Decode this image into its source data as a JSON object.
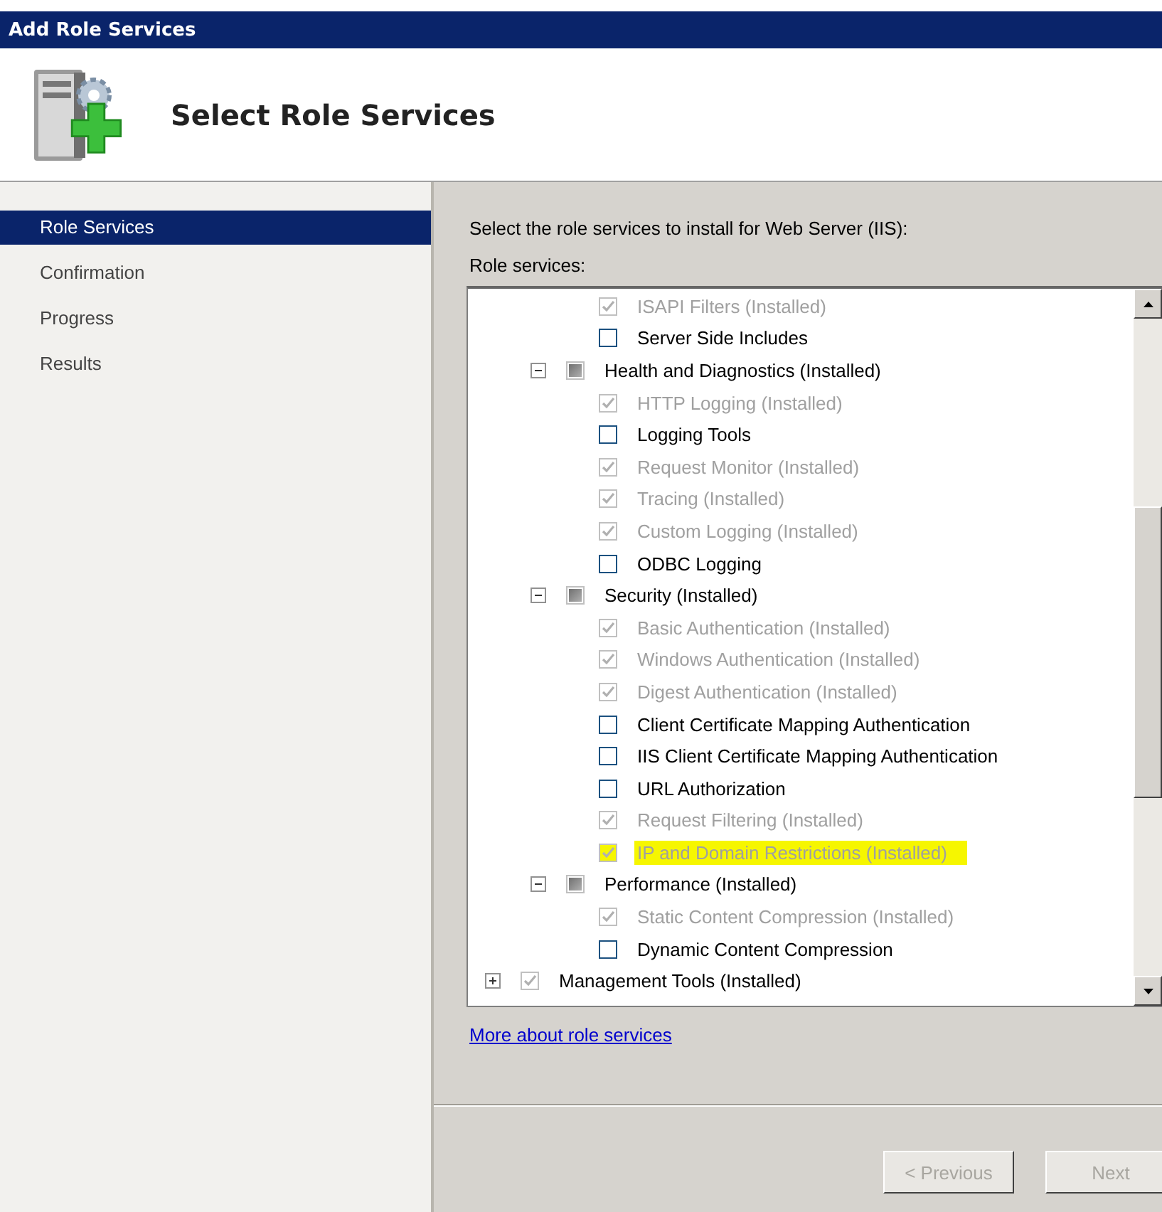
{
  "window": {
    "title": "Add Role Services"
  },
  "header": {
    "title": "Select Role Services"
  },
  "steps": [
    {
      "label": "Role Services",
      "selected": true
    },
    {
      "label": "Confirmation",
      "selected": false
    },
    {
      "label": "Progress",
      "selected": false
    },
    {
      "label": "Results",
      "selected": false
    }
  ],
  "content": {
    "instruction": "Select the role services to install for Web Server (IIS):",
    "list_label": "Role services:",
    "role_services": [
      {
        "children": [
          {
            "children": [
              {
                "label": "ISAPI Filters (Installed)",
                "checked": true,
                "disabled": true,
                "highlighted": false
              },
              {
                "label": "Server Side Includes",
                "checked": false,
                "disabled": false,
                "highlighted": false
              }
            ]
          },
          {
            "label": "Health and Diagnostics (Installed)",
            "checked": false,
            "partial": true,
            "expanded": true,
            "children": [
              {
                "label": "HTTP Logging (Installed)",
                "checked": true,
                "disabled": true,
                "highlighted": false
              },
              {
                "label": "Logging Tools",
                "checked": false,
                "disabled": false,
                "highlighted": false
              },
              {
                "label": "Request Monitor (Installed)",
                "checked": true,
                "disabled": true,
                "highlighted": false
              },
              {
                "label": "Tracing (Installed)",
                "checked": true,
                "disabled": true,
                "highlighted": false
              },
              {
                "label": "Custom Logging (Installed)",
                "checked": true,
                "disabled": true,
                "highlighted": false
              },
              {
                "label": "ODBC Logging",
                "checked": false,
                "disabled": false,
                "highlighted": false
              }
            ]
          },
          {
            "label": "Security (Installed)",
            "checked": false,
            "partial": true,
            "expanded": true,
            "children": [
              {
                "label": "Basic Authentication (Installed)",
                "checked": true,
                "disabled": true,
                "highlighted": false
              },
              {
                "label": "Windows Authentication (Installed)",
                "checked": true,
                "disabled": true,
                "highlighted": false
              },
              {
                "label": "Digest Authentication (Installed)",
                "checked": true,
                "disabled": true,
                "highlighted": false
              },
              {
                "label": "Client Certificate Mapping Authentication",
                "checked": false,
                "disabled": false,
                "highlighted": false
              },
              {
                "label": "IIS Client Certificate Mapping Authentication",
                "checked": false,
                "disabled": false,
                "highlighted": false
              },
              {
                "label": "URL Authorization",
                "checked": false,
                "disabled": false,
                "highlighted": false
              },
              {
                "label": "Request Filtering (Installed)",
                "checked": true,
                "disabled": true,
                "highlighted": false
              },
              {
                "label": "IP and Domain Restrictions (Installed)",
                "checked": true,
                "disabled": true,
                "highlighted": true
              }
            ]
          },
          {
            "label": "Performance (Installed)",
            "checked": false,
            "partial": true,
            "expanded": true,
            "children": [
              {
                "label": "Static Content Compression (Installed)",
                "checked": true,
                "disabled": true,
                "highlighted": false
              },
              {
                "label": "Dynamic Content Compression",
                "checked": false,
                "disabled": false,
                "highlighted": false
              }
            ]
          }
        ]
      },
      {
        "label": "Management Tools (Installed)",
        "checked": true,
        "expanded": false
      }
    ],
    "link": "More about role services"
  },
  "buttons": [
    {
      "label": "< Previous",
      "disabled": true
    },
    {
      "label": "Next",
      "disabled": true
    }
  ]
}
